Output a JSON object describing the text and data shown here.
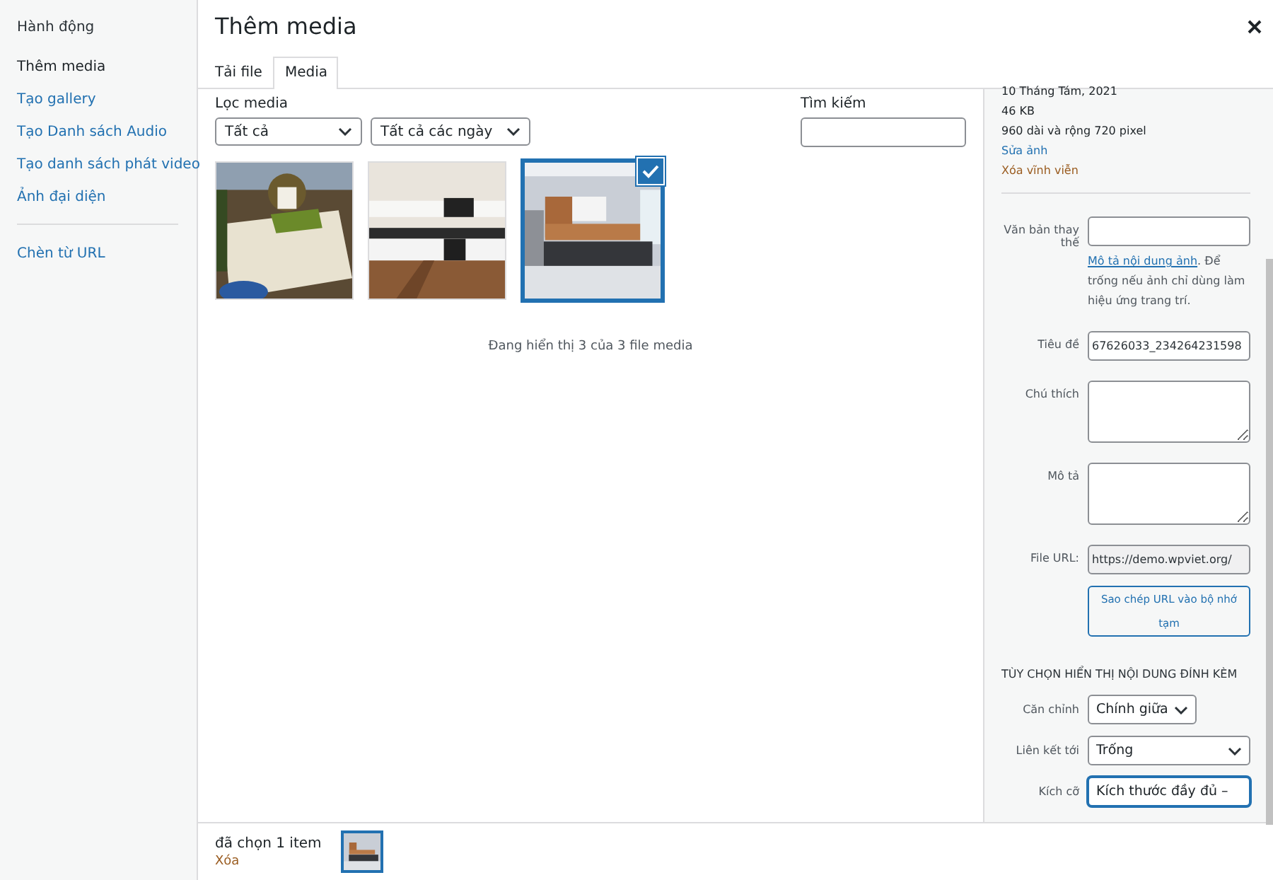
{
  "sidebar": {
    "heading": "Hành động",
    "groups": [
      [
        {
          "label": "Thêm media",
          "selected": true
        },
        {
          "label": "Tạo gallery",
          "selected": false
        },
        {
          "label": "Tạo Danh sách Audio",
          "selected": false
        },
        {
          "label": "Tạo danh sách phát video",
          "selected": false
        },
        {
          "label": "Ảnh đại diện",
          "selected": false
        }
      ],
      [
        {
          "label": "Chèn từ URL",
          "selected": false
        }
      ]
    ]
  },
  "title": "Thêm media",
  "tabs": [
    {
      "label": "Tải file",
      "selected": false
    },
    {
      "label": "Media",
      "selected": true
    }
  ],
  "filters": {
    "label": "Lọc media",
    "selects": [
      "Tất cả",
      "Tất cả các ngày"
    ],
    "search_label": "Tìm kiếm"
  },
  "media": {
    "items": [
      {
        "kind": "picture",
        "selected": false
      },
      {
        "kind": "picture",
        "selected": false
      },
      {
        "kind": "picture",
        "selected": true
      }
    ],
    "status": "Đang hiển thị 3 của 3 file media"
  },
  "details": {
    "meta": [
      "10 Tháng Tám, 2021",
      "46 KB",
      "960 dài và rộng 720 pixel"
    ],
    "links": [
      {
        "label": "Sửa ảnh",
        "kind": "edit"
      },
      {
        "label": "Xóa vĩnh viễn",
        "kind": "delete"
      }
    ],
    "fields": [
      {
        "label": "Văn bản thay thế",
        "kind": "input",
        "help_link": "Mô tả nội dung ảnh",
        "help": ". Để trống nếu ảnh chỉ dùng làm hiệu ứng trang trí."
      },
      {
        "label": "Tiêu đề",
        "kind": "input",
        "value": "67626033_234264231598"
      },
      {
        "label": "Chú thích",
        "kind": "textarea"
      },
      {
        "label": "Mô tả",
        "kind": "textarea"
      },
      {
        "label": "File URL:",
        "kind": "readonly",
        "value": "https://demo.wpviet.org/"
      }
    ],
    "copy_button": "Sao chép URL vào bộ nhớ tạm",
    "section_title": "TÙY CHỌN HIỂN THỊ NỘI DUNG ĐÍNH KÈM",
    "settings": [
      {
        "label": "Căn chỉnh",
        "value": "Chính giữa",
        "focused": false
      },
      {
        "label": "Liên kết tới",
        "value": "Trống",
        "focused": false
      },
      {
        "label": "Kích cỡ",
        "value": "Kích thước đầy đủ –",
        "focused": true
      }
    ]
  },
  "footer": {
    "count": "đã chọn 1 item",
    "clear": "Xóa",
    "thumbnail": {
      "kind": "picture"
    }
  }
}
